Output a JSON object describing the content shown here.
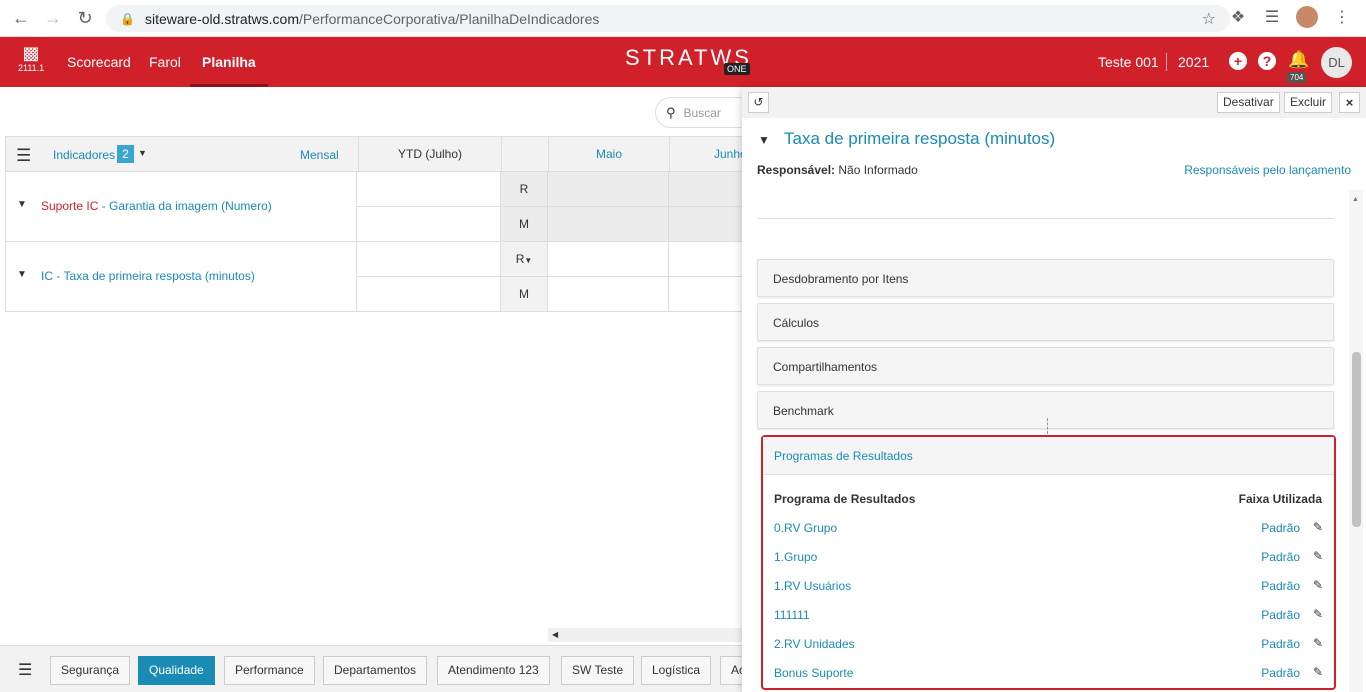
{
  "browser": {
    "url_host": "siteware-old.stratws.com",
    "url_path": "/PerformanceCorporativa/PlanilhaDeIndicadores"
  },
  "header": {
    "logo_version": "2111.1",
    "nav": [
      "Scorecard",
      "Farol",
      "Planilha"
    ],
    "brand": "STRATWS",
    "brand_suffix": "ONE",
    "user_name": "Teste 001",
    "year": "2021",
    "notification_count": "704",
    "avatar_initials": "DL"
  },
  "search": {
    "placeholder": "Buscar"
  },
  "grid": {
    "indicators_label": "Indicadores",
    "indicators_count": "2",
    "period": "Mensal",
    "col_ytd": "YTD (Julho)",
    "col_may": "Maio",
    "col_june": "Junho",
    "rows": [
      {
        "prefix": "Suporte IC",
        "name": " - Garantia da imagem (Numero)",
        "r": "R",
        "m": "M"
      },
      {
        "prefix": "IC",
        "name": " - Taxa de primeira resposta (minutos)",
        "r": "R",
        "m": "M"
      }
    ]
  },
  "bottom_tabs": [
    "Segurança",
    "Qualidade",
    "Performance",
    "Departamentos",
    "Atendimento 123",
    "SW Teste",
    "Logística",
    "Ac"
  ],
  "panel": {
    "btn_deactivate": "Desativar",
    "btn_delete": "Excluir",
    "title": "Taxa de primeira resposta (minutos)",
    "responsible_label": "Responsável:",
    "responsible_value": "Não Informado",
    "responsible_link": "Responsáveis pelo lançamento",
    "accordions": [
      "Desdobramento por Itens",
      "Cálculos",
      "Compartilhamentos",
      "Benchmark"
    ],
    "programs": {
      "title": "Programas de Resultados",
      "col_program": "Programa de Resultados",
      "col_range": "Faixa Utilizada",
      "items": [
        {
          "name": "0.RV Grupo",
          "range": "Padrão"
        },
        {
          "name": "1.Grupo",
          "range": "Padrão"
        },
        {
          "name": "1.RV Usuários",
          "range": "Padrão"
        },
        {
          "name": "111111",
          "range": "Padrão"
        },
        {
          "name": "2.RV Unidades",
          "range": "Padrão"
        },
        {
          "name": "Bonus Suporte",
          "range": "Padrão"
        }
      ]
    }
  }
}
